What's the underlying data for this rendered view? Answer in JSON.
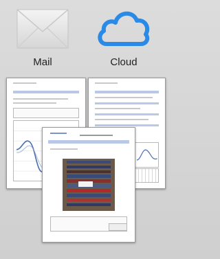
{
  "apps": {
    "mail": {
      "label": "Mail",
      "icon": "envelope-icon"
    },
    "cloud": {
      "label": "Cloud",
      "icon": "cloud-icon",
      "color": "#1e7fe0"
    }
  },
  "documents": [
    {
      "name": "document-chart-report"
    },
    {
      "name": "document-table-report"
    },
    {
      "name": "document-photo-report"
    }
  ]
}
